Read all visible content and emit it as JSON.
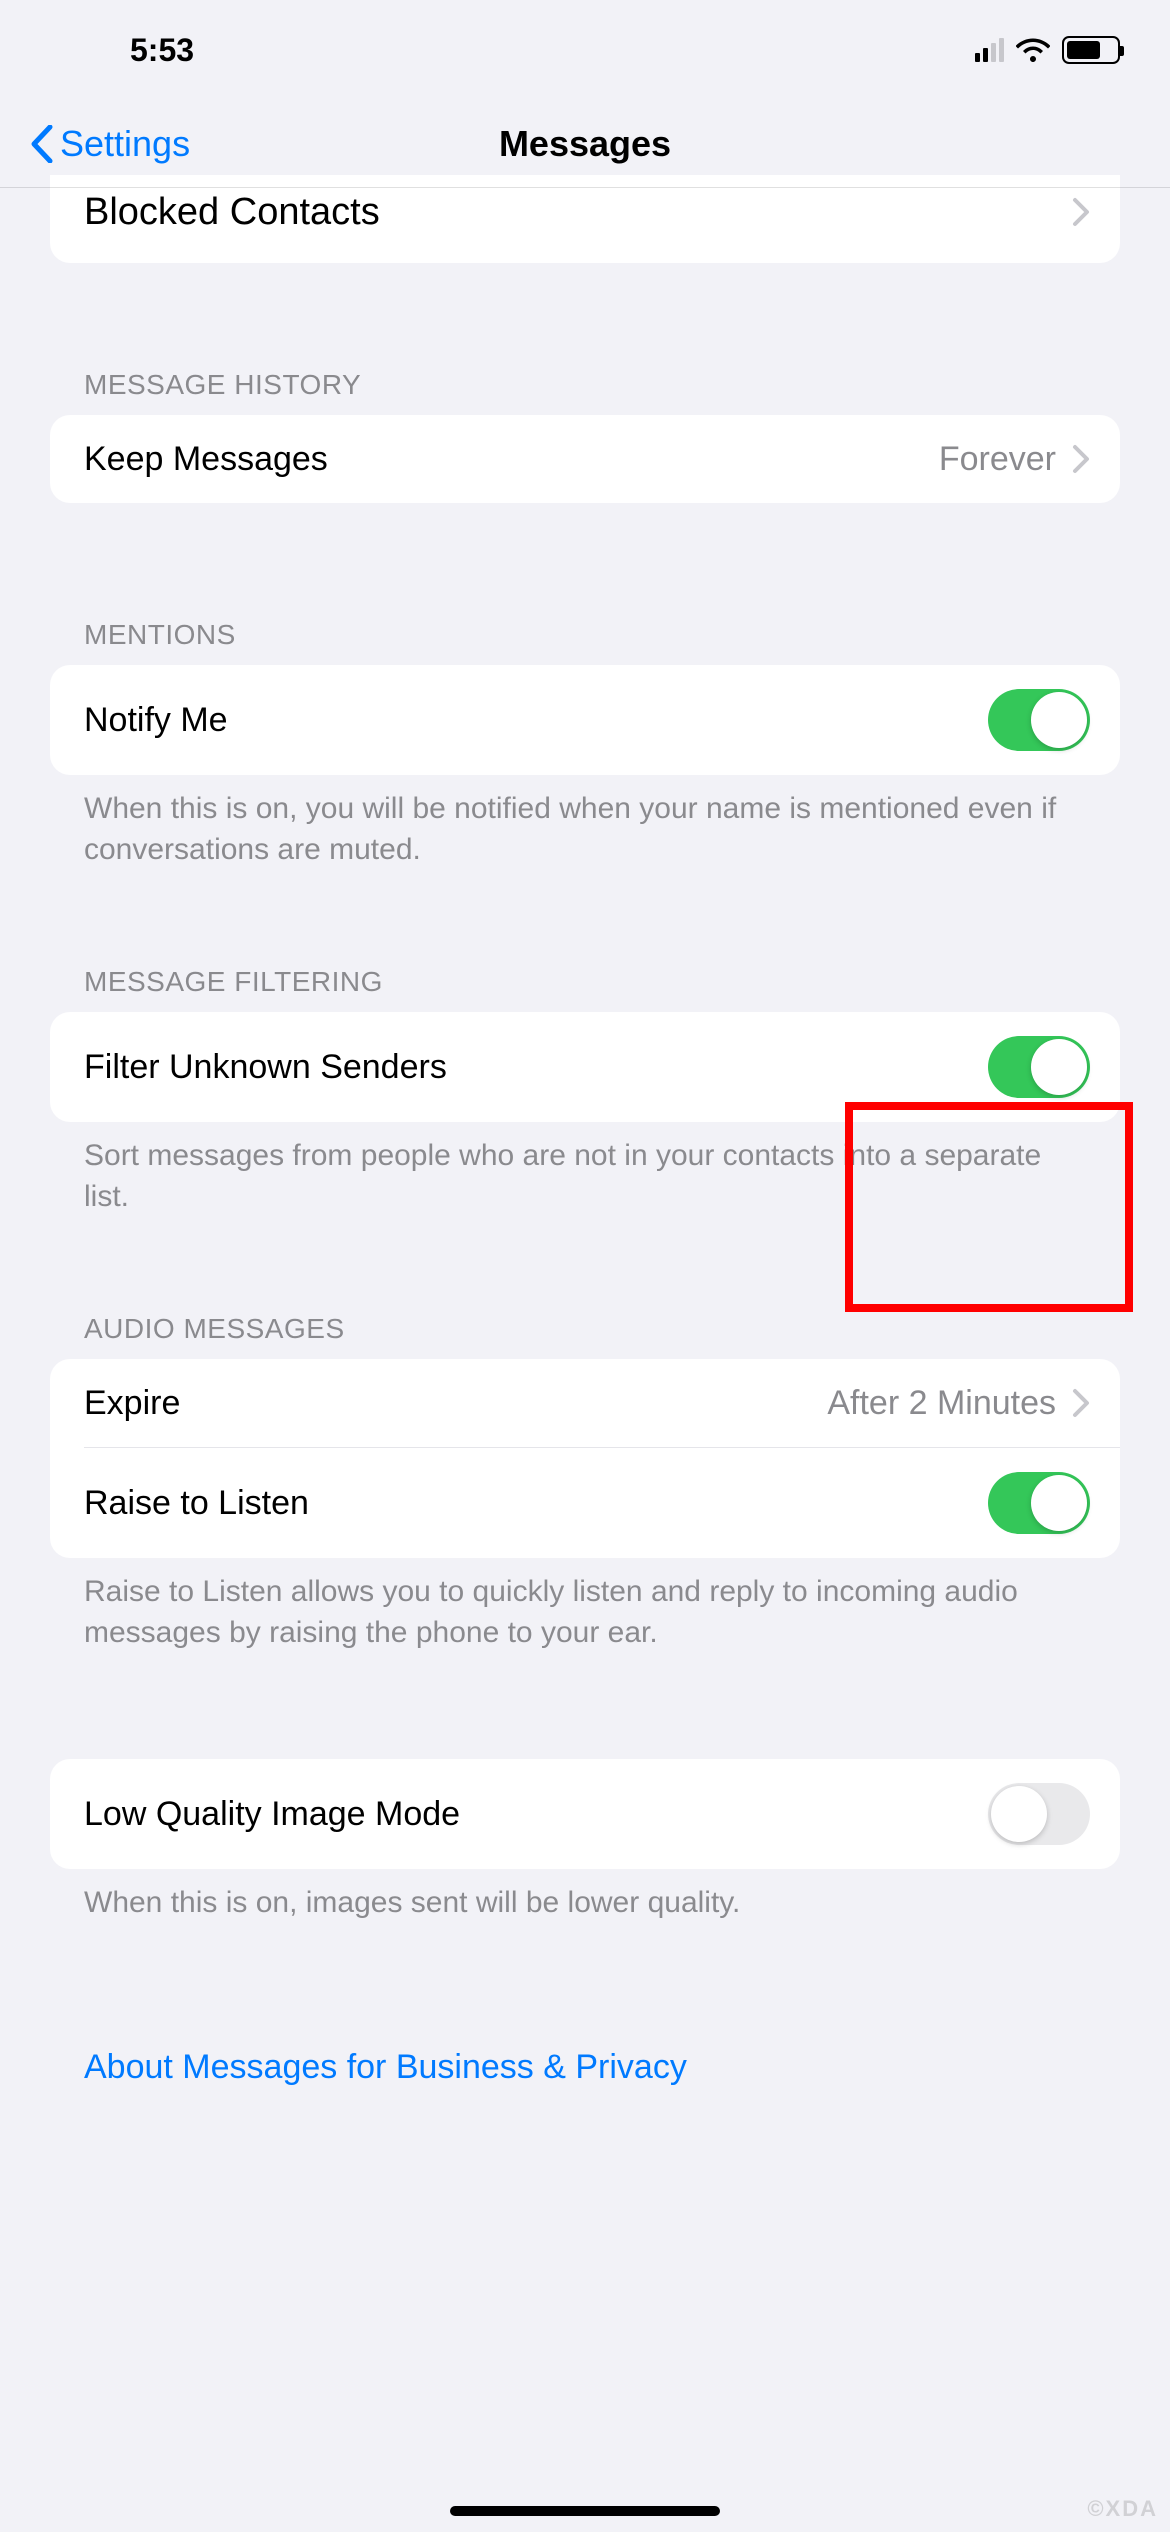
{
  "status": {
    "time": "5:53"
  },
  "nav": {
    "back_label": "Settings",
    "title": "Messages"
  },
  "partial": {
    "blocked_contacts": "Blocked Contacts"
  },
  "sections": {
    "history": {
      "header": "MESSAGE HISTORY",
      "keep_label": "Keep Messages",
      "keep_value": "Forever"
    },
    "mentions": {
      "header": "MENTIONS",
      "notify_label": "Notify Me",
      "notify_on": true,
      "footer": "When this is on, you will be notified when your name is mentioned even if conversations are muted."
    },
    "filtering": {
      "header": "MESSAGE FILTERING",
      "filter_label": "Filter Unknown Senders",
      "filter_on": true,
      "footer": "Sort messages from people who are not in your contacts into a separate list."
    },
    "audio": {
      "header": "AUDIO MESSAGES",
      "expire_label": "Expire",
      "expire_value": "After 2 Minutes",
      "raise_label": "Raise to Listen",
      "raise_on": true,
      "footer": "Raise to Listen allows you to quickly listen and reply to incoming audio messages by raising the phone to your ear."
    },
    "low_quality": {
      "label": "Low Quality Image Mode",
      "on": false,
      "footer": "When this is on, images sent will be lower quality."
    },
    "about_link": "About Messages for Business & Privacy"
  },
  "watermark": "©XDA"
}
